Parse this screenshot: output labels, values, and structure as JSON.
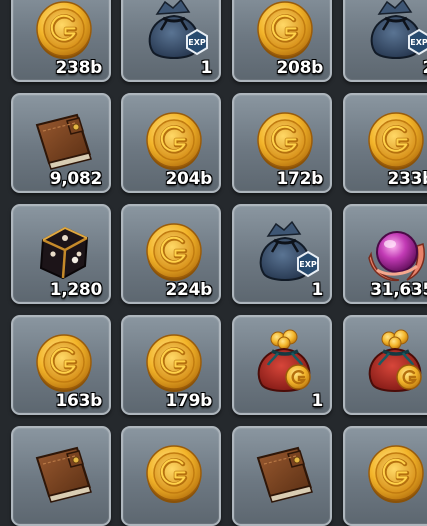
{
  "inventory": {
    "slots": [
      {
        "item": "gold-coin",
        "qty": "238b"
      },
      {
        "item": "exp-bag",
        "qty": "1"
      },
      {
        "item": "gold-coin",
        "qty": "208b"
      },
      {
        "item": "exp-bag",
        "qty": "2"
      },
      {
        "item": "leather-wallet",
        "qty": "9,082"
      },
      {
        "item": "gold-coin",
        "qty": "204b"
      },
      {
        "item": "gold-coin",
        "qty": "172b"
      },
      {
        "item": "gold-coin",
        "qty": "233b"
      },
      {
        "item": "dark-dice",
        "qty": "1,280"
      },
      {
        "item": "gold-coin",
        "qty": "224b"
      },
      {
        "item": "exp-bag",
        "qty": "1"
      },
      {
        "item": "magic-orb",
        "qty": "31,635"
      },
      {
        "item": "gold-coin",
        "qty": "163b"
      },
      {
        "item": "gold-coin",
        "qty": "179b"
      },
      {
        "item": "red-coin-pouch",
        "qty": "1"
      },
      {
        "item": "red-coin-pouch",
        "qty": ""
      },
      {
        "item": "leather-wallet",
        "qty": ""
      },
      {
        "item": "gold-coin",
        "qty": ""
      },
      {
        "item": "leather-wallet",
        "qty": ""
      },
      {
        "item": "gold-coin",
        "qty": ""
      }
    ],
    "exp_badge_text": "EXP"
  }
}
